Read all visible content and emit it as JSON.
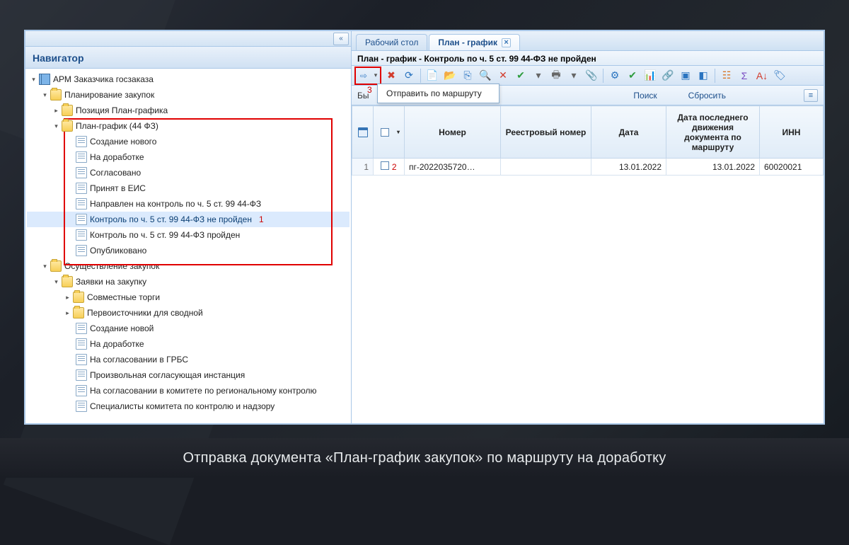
{
  "caption": "Отправка документа «План-график закупок» по маршруту на доработку",
  "navigator": {
    "title": "Навигатор",
    "collapse_glyph": "«"
  },
  "tree": {
    "root": {
      "label": "АРМ Заказчика госзаказа"
    },
    "planning": {
      "label": "Планирование закупок"
    },
    "position": {
      "label": "Позиция План-графика"
    },
    "plan44": {
      "label": "План-график (44 ФЗ)"
    },
    "plan44_items": [
      "Создание нового",
      "На доработке",
      "Согласовано",
      "Принят в ЕИС",
      "Направлен на контроль по ч. 5 ст. 99 44-ФЗ",
      "Контроль по ч. 5 ст. 99 44-ФЗ не пройден",
      "Контроль по ч. 5 ст. 99 44-ФЗ пройден",
      "Опубликовано"
    ],
    "procurement": {
      "label": "Осуществление закупок"
    },
    "requests": {
      "label": "Заявки на закупку"
    },
    "joint": {
      "label": "Совместные торги"
    },
    "sources": {
      "label": "Первоисточники для сводной"
    },
    "req_items": [
      "Создание новой",
      "На доработке",
      "На согласовании в ГРБС",
      "Произвольная согласующая инстанция",
      "На согласовании в комитете по региональному контролю",
      "Специалисты комитета по контролю и надзору"
    ]
  },
  "annotations": {
    "one": "1",
    "two": "2",
    "three": "3"
  },
  "tabs": [
    {
      "label": "Рабочий стол",
      "active": false
    },
    {
      "label": "План - график",
      "active": true
    }
  ],
  "subtitle": "План - график - Контроль по ч. 5 ст. 99 44-ФЗ не пройден",
  "route_menu": {
    "send": "Отправить по маршруту"
  },
  "filter": {
    "left_label_partial": "Бы",
    "search": "Поиск",
    "reset": "Сбросить"
  },
  "grid": {
    "headers": {
      "number": "Номер",
      "reg": "Реестровый номер",
      "date": "Дата",
      "ldate": "Дата последнего движения документа по маршруту",
      "inn": "ИНН"
    },
    "rows": [
      {
        "rn": "1",
        "num": "пг-2022035720…",
        "reg": "",
        "date": "13.01.2022",
        "ldate": "13.01.2022",
        "inn": "60020021"
      }
    ]
  }
}
